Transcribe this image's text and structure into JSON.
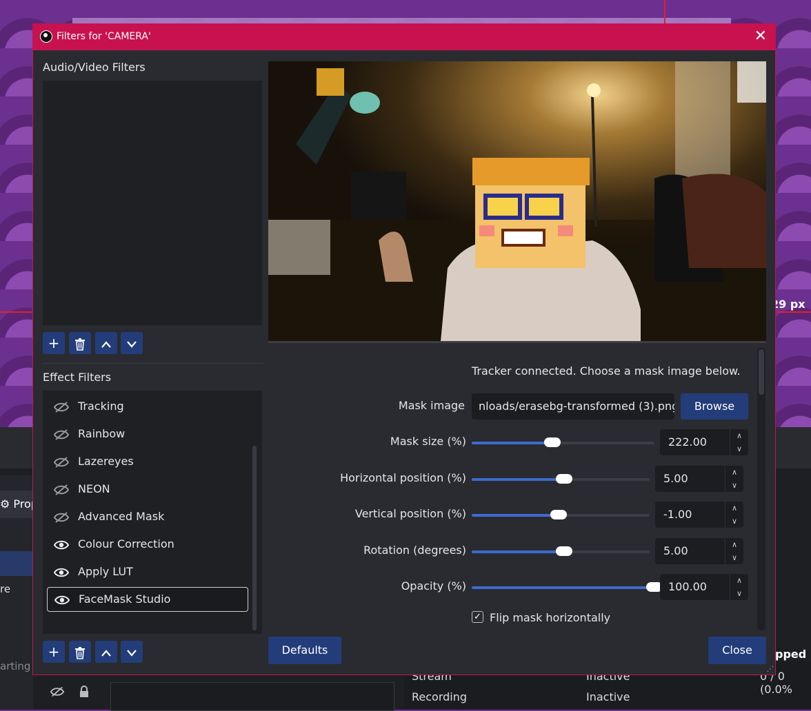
{
  "background": {
    "px_label": "29 px",
    "properties_tab": "⚙ Prope",
    "left_text_1": "re",
    "left_text_2": "arting",
    "opped": "pped",
    "stats": [
      {
        "label": "Stream",
        "value": "Inactive",
        "extra": "0 / 0 (0.0%"
      },
      {
        "label": "Recording",
        "value": "Inactive"
      }
    ]
  },
  "dialog": {
    "title": "Filters for 'CAMERA'",
    "close_icon": "✕",
    "audio_video_label": "Audio/Video Filters",
    "effect_label": "Effect Filters",
    "toolbar": {
      "add": "+",
      "remove_icon": "trash-icon",
      "up": "∧",
      "down": "∨"
    },
    "effect_filters": [
      {
        "name": "Tracking",
        "enabled": false
      },
      {
        "name": "Rainbow",
        "enabled": false
      },
      {
        "name": "Lazereyes",
        "enabled": false
      },
      {
        "name": "NEON",
        "enabled": false
      },
      {
        "name": "Advanced Mask",
        "enabled": false
      },
      {
        "name": "Colour Correction",
        "enabled": true
      },
      {
        "name": "Apply LUT",
        "enabled": true
      },
      {
        "name": "FaceMask Studio",
        "enabled": true,
        "selected": true
      }
    ],
    "properties": {
      "status": "Tracker connected. Choose a mask image below.",
      "mask_image_label": "Mask image",
      "mask_image_value": "nloads/erasebg-transformed (3).png",
      "browse": "Browse",
      "sliders": [
        {
          "label": "Mask size (%)",
          "value": "222.00",
          "fraction": 0.44
        },
        {
          "label": "Horizontal position (%)",
          "value": "5.00",
          "fraction": 0.52
        },
        {
          "label": "Vertical position (%)",
          "value": "-1.00",
          "fraction": 0.49
        },
        {
          "label": "Rotation (degrees)",
          "value": "5.00",
          "fraction": 0.52
        },
        {
          "label": "Opacity (%)",
          "value": "100.00",
          "fraction": 1.0
        }
      ],
      "flip_label": "Flip mask horizontally",
      "flip_checked": true
    },
    "defaults": "Defaults",
    "close": "Close"
  },
  "colors": {
    "accent": "#c8124f",
    "button": "#233d7a",
    "slider": "#3d6bd0"
  }
}
